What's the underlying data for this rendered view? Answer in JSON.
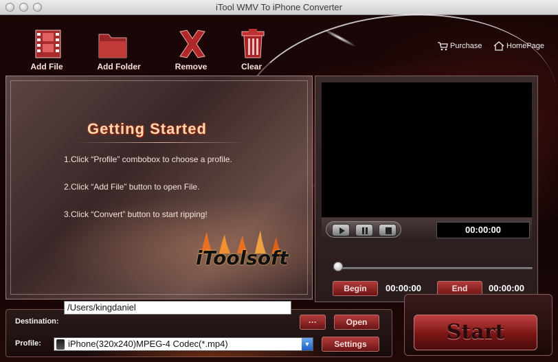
{
  "window": {
    "title": "iTool WMV To iPhone Converter"
  },
  "toolbar": {
    "add_file": "Add File",
    "add_folder": "Add Folder",
    "remove": "Remove",
    "clear": "Clear"
  },
  "links": {
    "purchase": "Purchase",
    "homepage": "HomePage"
  },
  "getting_started": {
    "title": "Getting  Started",
    "steps": [
      "1.Click “Profile” combobox to choose a profile.",
      "2.Click “Add File” button to open File.",
      "3.Click “Convert” button to start ripping!"
    ],
    "brand": "iToolsoft"
  },
  "player": {
    "current_time": "00:00:00",
    "begin_label": "Begin",
    "begin_time": "00:00:00",
    "end_label": "End",
    "end_time": "00:00:00",
    "position": 0
  },
  "output": {
    "destination_label": "Destination:",
    "destination_value": "/Users/kingdaniel",
    "browse_label": "···",
    "open_label": "Open",
    "profile_label": "Profile:",
    "profile_value": "iPhone(320x240)MPEG-4 Codec(*.mp4)",
    "settings_label": "Settings"
  },
  "start_label": "Start"
}
